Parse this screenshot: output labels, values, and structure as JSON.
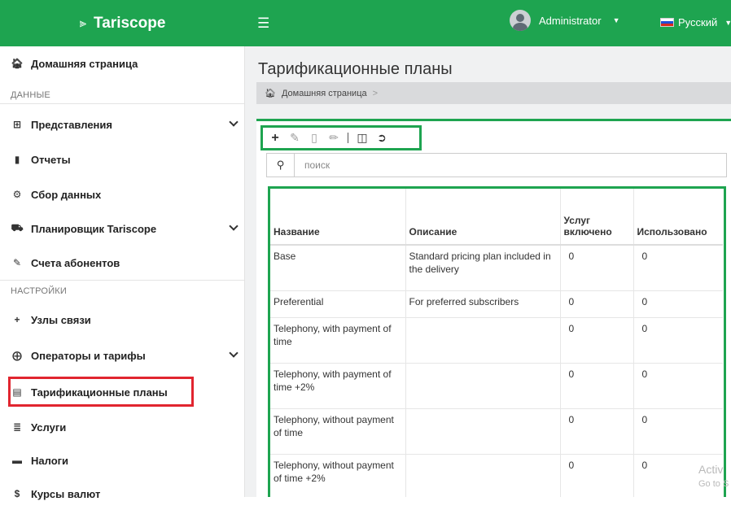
{
  "brand": {
    "name": "Tariscope",
    "logo_icon": "tariscope-logo-icon"
  },
  "topbar": {
    "menu_icon": "hamburger-icon",
    "user": "Administrator",
    "language": "Русский"
  },
  "sidebar": {
    "home": "Домашняя страница",
    "section_data": "ДАННЫЕ",
    "views": "Представления",
    "reports": "Отчеты",
    "data_collection": "Сбор данных",
    "scheduler": "Планировщик Tariscope",
    "subscriber_accounts": "Счета абонентов",
    "section_settings": "НАСТРОЙКИ",
    "nodes": "Узлы связи",
    "operators": "Операторы и тарифы",
    "tariff_plans": "Тарификационные планы",
    "services": "Услуги",
    "taxes": "Налоги",
    "currency": "Курсы валют"
  },
  "main": {
    "title": "Тарификационные планы",
    "breadcrumb_home": "Домашняя страница",
    "breadcrumb_sep": ">",
    "search_placeholder": "поиск",
    "columns": [
      "Название",
      "Описание",
      "Услуг включено",
      "Использовано"
    ],
    "rows": [
      [
        "Base",
        "Standard pricing plan included in the delivery",
        "0",
        "0"
      ],
      [
        "Preferential",
        "For preferred subscribers",
        "0",
        "0"
      ],
      [
        "Telephony, with payment of time",
        "",
        "0",
        "0"
      ],
      [
        "Telephony, with payment of time +2%",
        "",
        "0",
        "0"
      ],
      [
        "Telephony, without payment of time",
        "",
        "0",
        "0"
      ],
      [
        "Telephony, without payment of time +2%",
        "",
        "0",
        "0"
      ]
    ]
  },
  "watermark": {
    "line1": "Activ",
    "line2": "Go to S"
  },
  "colors": {
    "accent": "#1ea450",
    "highlight": "#e1252f",
    "breadcrumb_bg": "#d9dadc"
  }
}
